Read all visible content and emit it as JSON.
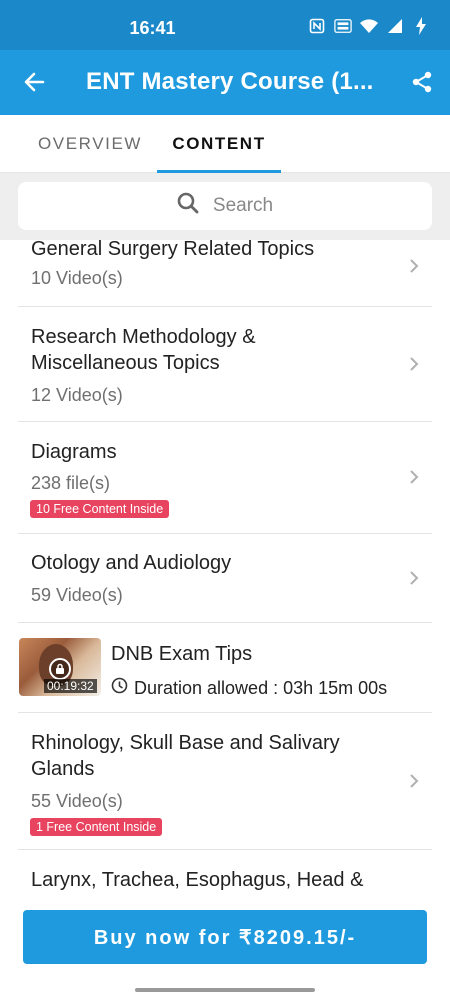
{
  "status_bar": {
    "time": "16:41",
    "icons": [
      "nfc-icon",
      "vowifi-icon",
      "wifi-icon",
      "signal-icon",
      "charging-icon"
    ]
  },
  "app_bar": {
    "title": "ENT Mastery Course (1...",
    "back_icon": "back-arrow-icon",
    "share_icon": "share-icon"
  },
  "tabs": [
    {
      "label": "OVERVIEW",
      "active": false
    },
    {
      "label": "CONTENT",
      "active": true
    }
  ],
  "search": {
    "placeholder": "Search"
  },
  "list": [
    {
      "title": "General Surgery Related Topics",
      "subtitle": "10 Video(s)"
    },
    {
      "title": "Research Methodology & Miscellaneous Topics",
      "subtitle": "12 Video(s)"
    },
    {
      "title": "Diagrams",
      "subtitle": "238 file(s)",
      "badge": "10 Free Content Inside"
    },
    {
      "title": "Otology and Audiology",
      "subtitle": "59 Video(s)"
    },
    {
      "type": "video",
      "title": "DNB Exam Tips",
      "thumb_duration": "00:19:32",
      "duration_text": "Duration allowed : 03h 15m 00s"
    },
    {
      "title": "Rhinology, Skull Base and Salivary Glands",
      "subtitle": "55 Video(s)",
      "badge": "1 Free Content Inside"
    },
    {
      "title": "Larynx, Trachea, Esophagus, Head &"
    }
  ],
  "buy_button": {
    "label": "Buy now for ₹8209.15/-"
  },
  "colors": {
    "primary": "#1f9ade",
    "status_bar": "#1a88c9",
    "badge": "#e8435f"
  }
}
